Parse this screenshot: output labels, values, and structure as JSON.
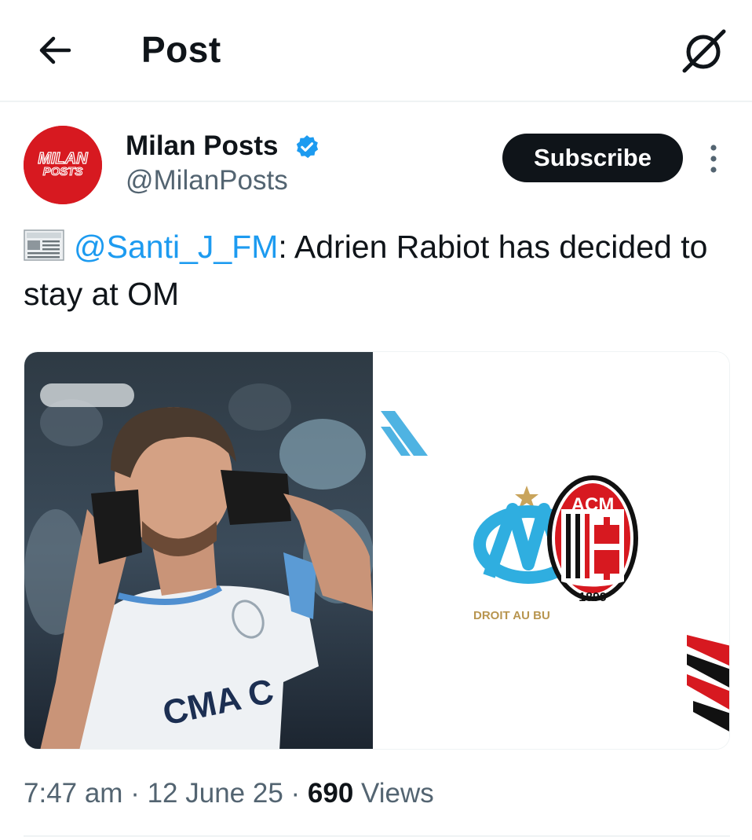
{
  "header": {
    "title": "Post"
  },
  "author": {
    "display_name": "Milan Posts",
    "handle": "@MilanPosts",
    "avatar_text_line1": "MILAN",
    "avatar_text_line2": "POSTS"
  },
  "actions": {
    "subscribe_label": "Subscribe"
  },
  "tweet": {
    "mention": "@Santi_J_FM",
    "text": ": Adrien Rabiot has decided to stay at OM"
  },
  "media": {
    "shirt_sponsor": "CMA C",
    "om_motto": "DROIT AU BU",
    "acm_text": "ACM",
    "acm_year": "1899"
  },
  "meta": {
    "time": "7:47 am",
    "date": "12 June 25",
    "views_count": "690",
    "views_label": "Views",
    "separator": " · "
  },
  "colors": {
    "accent": "#1d9bf0",
    "text_primary": "#0f1419",
    "text_secondary": "#536471",
    "om_blue": "#2faee0",
    "milan_red": "#d71920"
  },
  "icons": {
    "back": "arrow-left-icon",
    "grok": "grok-icon",
    "verified": "verified-badge-icon",
    "more": "more-vertical-icon",
    "news": "newspaper-icon"
  }
}
